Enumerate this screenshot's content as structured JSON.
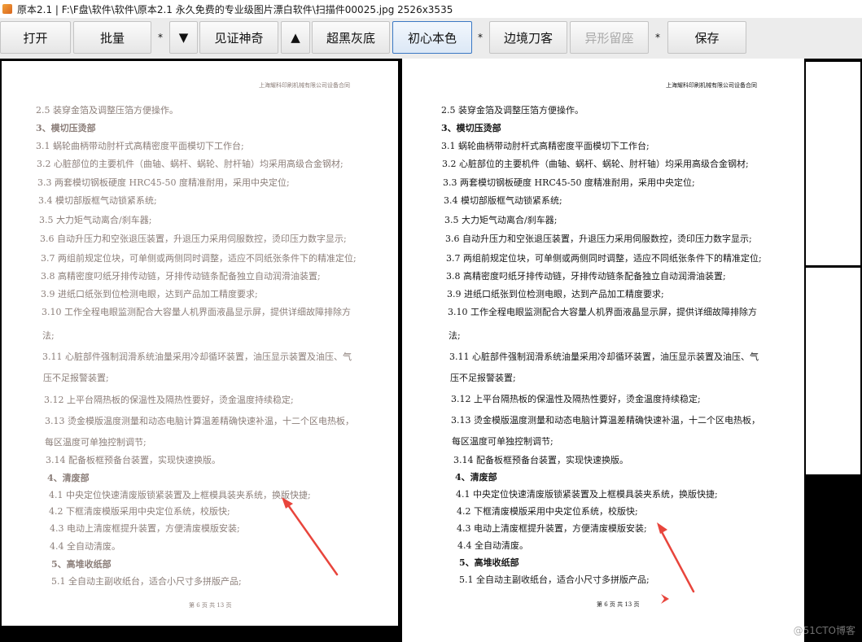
{
  "window": {
    "title": "原本2.1 | F:\\F盘\\软件\\软件\\原本2.1 永久免费的专业级图片漂白软件\\扫描件00025.jpg 2526x3535"
  },
  "toolbar": {
    "open": "打开",
    "batch": "批量",
    "sep1": "*",
    "down": "▼",
    "witness_magic": "见证神奇",
    "up": "▲",
    "super_black_gray": "超黑灰底",
    "original_color": "初心本色",
    "sep2": "*",
    "edge_knife": "边境刀客",
    "shape_keep": "异形留座",
    "sep3": "*",
    "save": "保存"
  },
  "document": {
    "header": "上海耀科印刷机械有限公司设备合同",
    "lines": [
      "2.5 装穿金箔及调整压箔方便操作。",
      "3、模切压烫部",
      "3.1 蜗轮曲柄带动肘杆式高精密度平面模切下工作台;",
      "3.2 心脏部位的主要机件（曲轴、蜗杆、蜗轮、肘杆轴）均采用高级合金钢材;",
      "3.3 两套模切钢板硬度 HRC45-50 度精准耐用，采用中央定位;",
      "3.4 模切部版框气动锁紧系统;",
      "3.5 大力矩气动离合/刹车器;",
      "3.6 自动升压力和空张退压装置，升退压力采用伺服数控，烫印压力数字显示;",
      "3.7 两组前规定位块，可单侧或两侧同时调整，适应不同纸张条件下的精准定位;",
      "3.8 高精密度叼纸牙排传动链，牙排传动链条配备独立自动润滑油装置;",
      "3.9 进纸口纸张到位检测电眼，达到产品加工精度要求;",
      "3.10 工作全程电眼监测配合大容量人机界面液晶显示屏，提供详细故障排除方",
      "法;",
      "3.11 心脏部件强制润滑系统油量采用冷却循环装置，油压显示装置及油压、气",
      "压不足报警装置;",
      "3.12 上平台隔热板的保温性及隔热性要好，烫金温度持续稳定;",
      "3.13 烫金模版温度测量和动态电脑计算温差精确快速补温，十二个区电热板，",
      "每区温度可单独控制调节;",
      "3.14 配备板框预备台装置，实现快速换版。",
      "4、清废部",
      "4.1 中央定位快速清废版锁紧装置及上框模具装夹系统，换版快捷;",
      "4.2 下框清废模版采用中央定位系统，校版快;",
      "4.3 电动上清废框提升装置，方便清废模版安装;",
      "4.4 全自动清废。",
      "5、高堆收纸部",
      "5.1 全自动主副收纸台，适合小尺寸多拼版产品;"
    ],
    "footer": "第 6 页 共 13 页"
  },
  "watermark": "@51CTO博客",
  "colors": {
    "left_text": "#8c7f7a",
    "right_text": "#181818",
    "arrow": "#e8453c",
    "active_border": "#3a78c4"
  }
}
